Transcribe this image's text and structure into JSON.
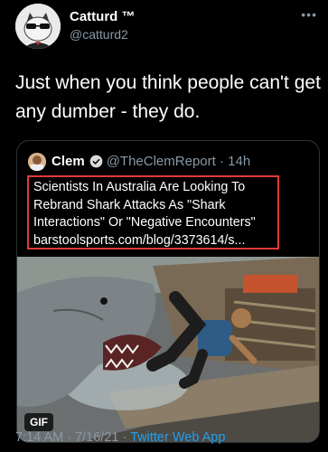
{
  "author": {
    "name": "Catturd ™",
    "handle": "@catturd2"
  },
  "tweet_text": "Just when you think people can't get any dumber - they do.",
  "quote": {
    "name": "Clem",
    "handle": "@TheClemReport",
    "time": "14h",
    "lines": [
      "Scientists In Australia Are Looking To",
      "Rebrand Shark Attacks As \"Shark",
      "Interactions\" Or \"Negative Encounters\"",
      "barstoolsports.com/blog/3373614/s..."
    ],
    "media_badge": "GIF"
  },
  "footer": {
    "timestamp": "7:14 AM · 7/16/21 ·",
    "source": "Twitter Web App"
  },
  "colors": {
    "background": "#000000",
    "highlight_border": "#e03a3a",
    "link": "#1da1f2",
    "verified": "#1da1f2"
  }
}
